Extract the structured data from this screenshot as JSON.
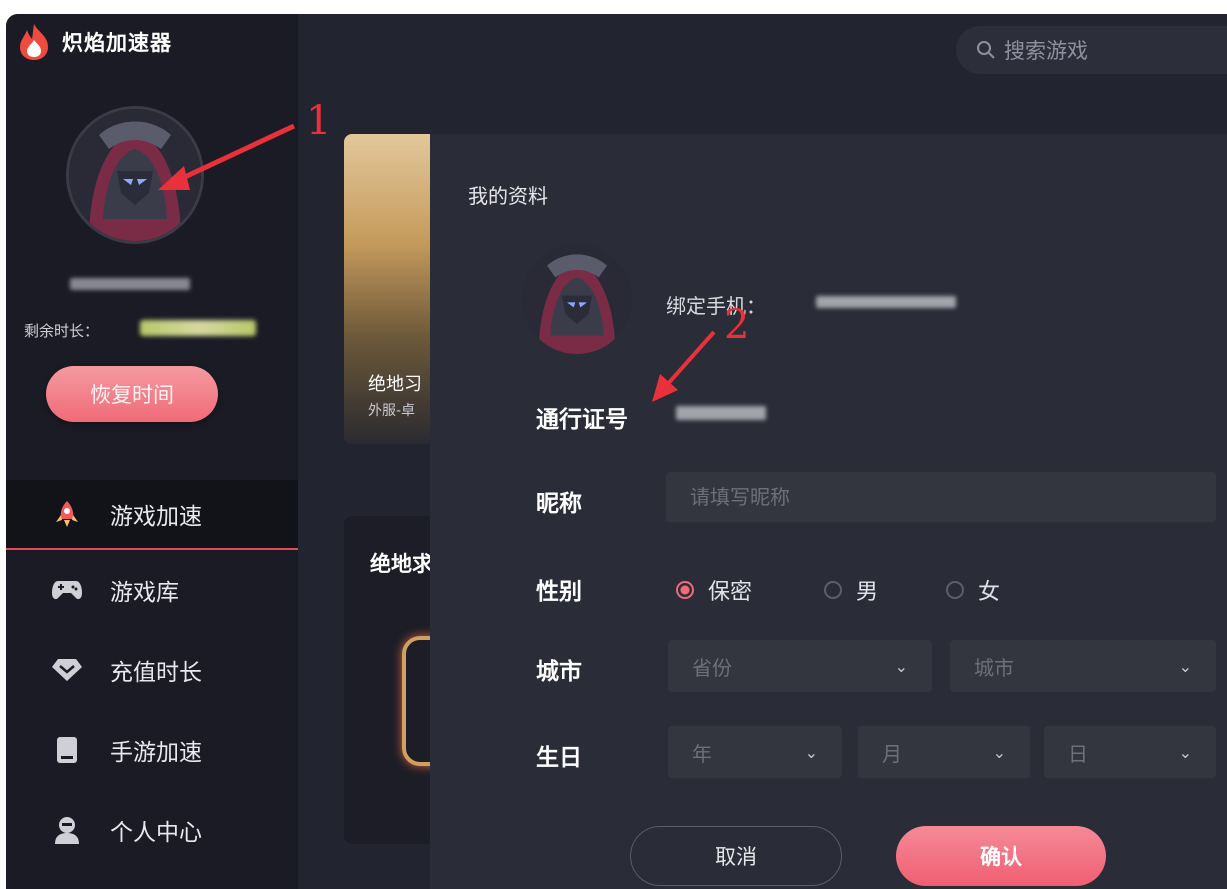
{
  "app": {
    "name": "炽焰加速器"
  },
  "search": {
    "placeholder": "搜索游戏"
  },
  "sidebar": {
    "remain_label": "剩余时长：",
    "restore_button": "恢复时间",
    "nav": [
      {
        "label": "游戏加速",
        "icon": "rocket-icon",
        "active": true
      },
      {
        "label": "游戏库",
        "icon": "gamepad-icon"
      },
      {
        "label": "充值时长",
        "icon": "diamond-icon"
      },
      {
        "label": "手游加速",
        "icon": "phone-icon"
      },
      {
        "label": "个人中心",
        "icon": "user-icon"
      }
    ]
  },
  "background": {
    "card_title": "绝地习",
    "card_sub": "外服-卓",
    "panel_title": "绝地求"
  },
  "modal": {
    "title": "我的资料",
    "phone_label": "绑定手机：",
    "pass_label": "通行证号",
    "nickname_label": "昵称",
    "nickname_placeholder": "请填写昵称",
    "gender_label": "性别",
    "gender_options": [
      "保密",
      "男",
      "女"
    ],
    "gender_selected": "保密",
    "city_label": "城市",
    "province_placeholder": "省份",
    "city_placeholder": "城市",
    "birthday_label": "生日",
    "year_placeholder": "年",
    "month_placeholder": "月",
    "day_placeholder": "日",
    "cancel_button": "取消",
    "confirm_button": "确认"
  },
  "annotations": {
    "step1": "1",
    "step2": "2"
  },
  "colors": {
    "accent": "#ef6b78",
    "annotation": "#e8313a",
    "sidebar_bg": "#1a1b24",
    "modal_bg": "#2a2c38"
  }
}
